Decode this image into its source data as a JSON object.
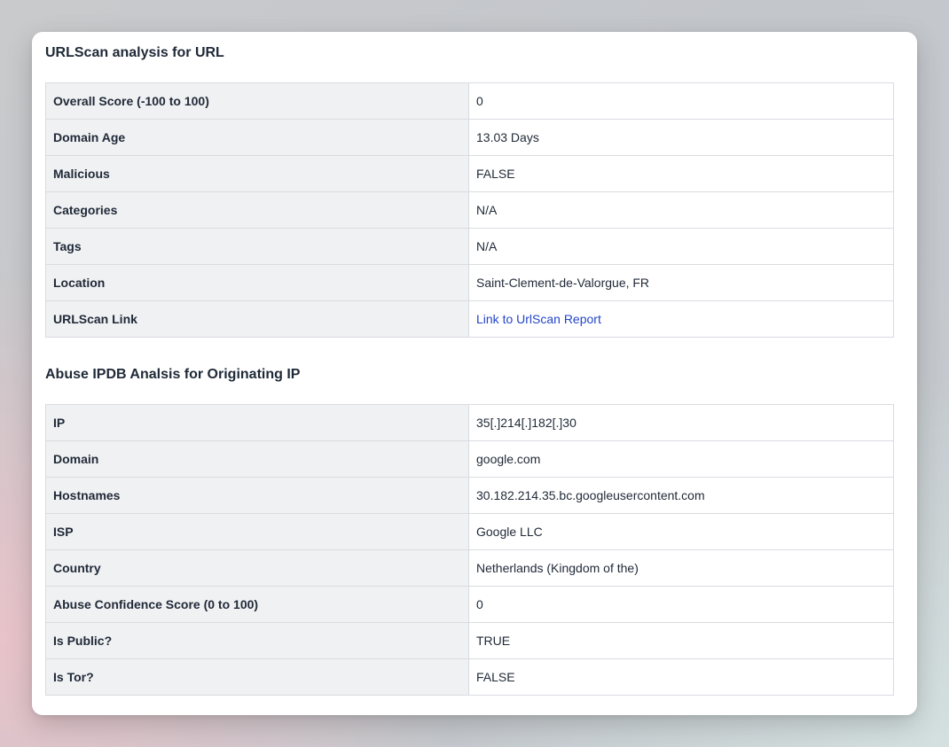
{
  "urlscan": {
    "title": "URLScan analysis for URL",
    "rows": [
      {
        "label": "Overall Score (-100 to 100)",
        "value": "0"
      },
      {
        "label": "Domain Age",
        "value": "13.03 Days"
      },
      {
        "label": "Malicious",
        "value": "FALSE"
      },
      {
        "label": "Categories",
        "value": "N/A"
      },
      {
        "label": "Tags",
        "value": "N/A"
      },
      {
        "label": "Location",
        "value": "Saint-Clement-de-Valorgue, FR"
      },
      {
        "label": "URLScan Link",
        "value": "Link to UrlScan Report"
      }
    ]
  },
  "abuseipdb": {
    "title": "Abuse IPDB Analsis for Originating IP",
    "rows": [
      {
        "label": "IP",
        "value": "35[.]214[.]182[.]30"
      },
      {
        "label": "Domain",
        "value": "google.com"
      },
      {
        "label": "Hostnames",
        "value": "30.182.214.35.bc.googleusercontent.com"
      },
      {
        "label": "ISP",
        "value": "Google LLC"
      },
      {
        "label": "Country",
        "value": "Netherlands (Kingdom of the)"
      },
      {
        "label": "Abuse Confidence Score (0 to 100)",
        "value": "0"
      },
      {
        "label": "Is Public?",
        "value": "TRUE"
      },
      {
        "label": "Is Tor?",
        "value": "FALSE"
      }
    ]
  },
  "colors": {
    "link": "#2446c8",
    "label_bg": "#f0f1f3",
    "border": "#d9dbe0"
  }
}
